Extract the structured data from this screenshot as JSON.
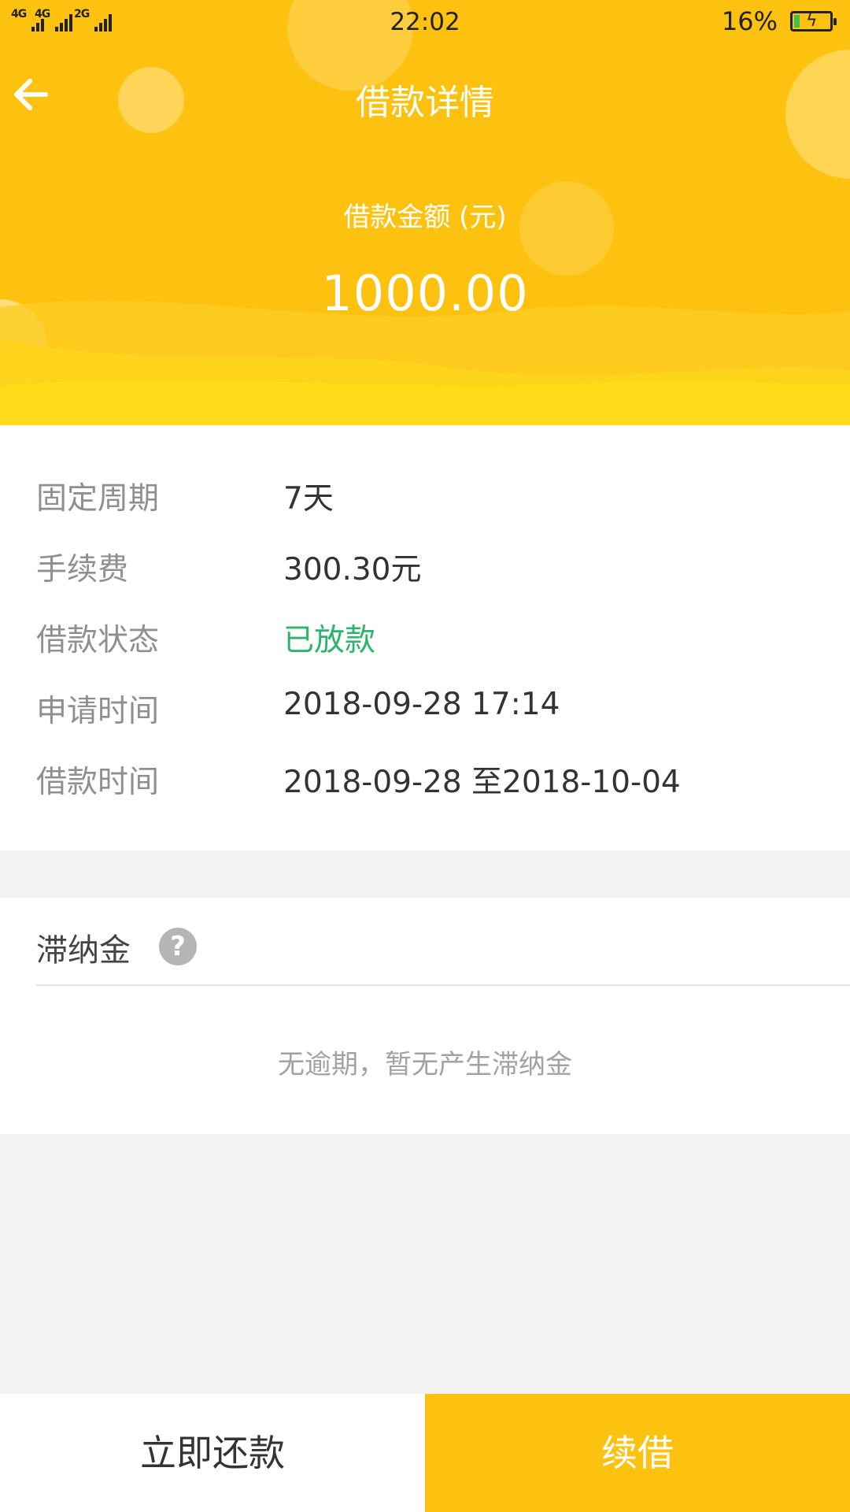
{
  "status_bar": {
    "network_1": "4G",
    "network_2": "4G",
    "network_3": "2G",
    "time": "22:02",
    "battery_percent": "16%",
    "battery_level": 0.16,
    "battery_fill_color": "#3cc24a"
  },
  "header": {
    "back_icon": "arrow-left-icon",
    "title": "借款详情",
    "amount_label": "借款金额 (元)",
    "amount_value": "1000.00",
    "background_color": "#fdc20f"
  },
  "details": [
    {
      "label": "固定周期",
      "value": "7天"
    },
    {
      "label": "手续费",
      "value": "300.30元"
    },
    {
      "label": "借款状态",
      "value": "已放款",
      "value_color": "#2db36a"
    },
    {
      "label": "申请时间",
      "value": "2018-09-28 17:14"
    },
    {
      "label": "借款时间",
      "value": "2018-09-28 至2018-10-04"
    }
  ],
  "late_fee": {
    "title": "滞纳金",
    "help_icon": "question-circle-icon",
    "help_glyph": "?",
    "empty_text": "无逾期，暂无产生滞纳金"
  },
  "actions": {
    "repay_label": "立即还款",
    "renew_label": "续借",
    "renew_color": "#fdc20f"
  }
}
